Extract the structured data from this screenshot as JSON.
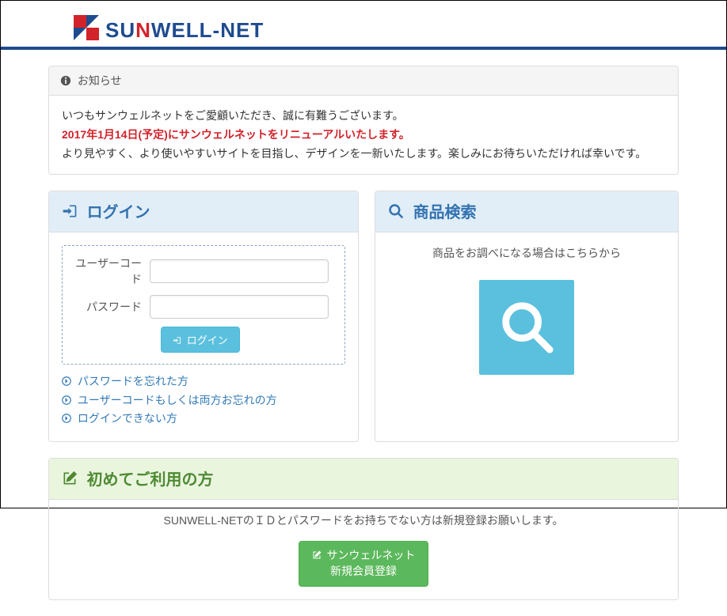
{
  "header": {
    "brand_prefix": "SU",
    "brand_red": "N",
    "brand_suffix": "WELL-NET"
  },
  "notice": {
    "title": "お知らせ",
    "line1": "いつもサンウェルネットをご愛顧いただき、誠に有難うございます。",
    "line2": "2017年1月14日(予定)にサンウェルネットをリニューアルいたします。",
    "line3": "より見やすく、より使いやすいサイトを目指し、デザインを一新いたします。楽しみにお待ちいただければ幸いです。"
  },
  "login": {
    "title": "ログイン",
    "user_label": "ユーザーコード",
    "password_label": "パスワード",
    "submit_label": "ログイン",
    "links": {
      "forgot_password": "パスワードを忘れた方",
      "forgot_both": "ユーザーコードもしくは両方お忘れの方",
      "cannot_login": "ログインできない方"
    }
  },
  "search": {
    "title": "商品検索",
    "desc": "商品をお調べになる場合はこちらから"
  },
  "register": {
    "title": "初めてご利用の方",
    "desc": "SUNWELL-NETのＩＤとパスワードをお持ちでない方は新規登録お願いします。",
    "button_line1": "サンウェルネット",
    "button_line2": "新規会員登録"
  }
}
